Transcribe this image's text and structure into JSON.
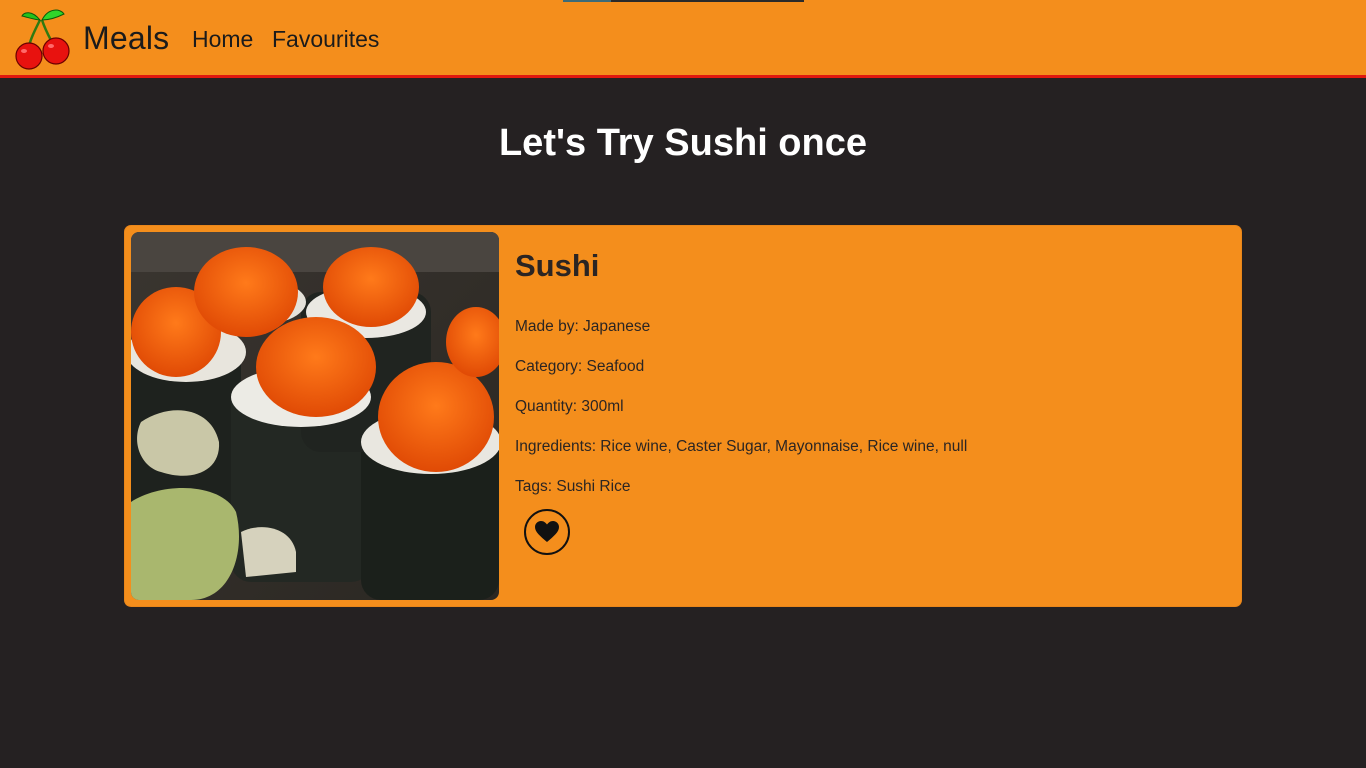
{
  "navbar": {
    "brand": "Meals",
    "links": [
      {
        "label": "Home"
      },
      {
        "label": "Favourites"
      }
    ],
    "logo_icon": "cherry-icon"
  },
  "page": {
    "title": "Let's Try Sushi once"
  },
  "meal": {
    "name": "Sushi",
    "image_subject": "sushi",
    "details": [
      {
        "label": "Made by: Japanese"
      },
      {
        "label": "Category: Seafood"
      },
      {
        "label": "Quantity: 300ml"
      },
      {
        "label": "Ingredients: Rice wine, Caster Sugar, Mayonnaise, Rice wine, null"
      },
      {
        "label": "Tags: Sushi Rice"
      }
    ],
    "favourite_icon": "heart-icon"
  },
  "colors": {
    "navbar": "#f48e1c",
    "navbar_border": "#e0180f",
    "background": "#252122",
    "card": "#f48e1c",
    "title": "#ffffff"
  }
}
